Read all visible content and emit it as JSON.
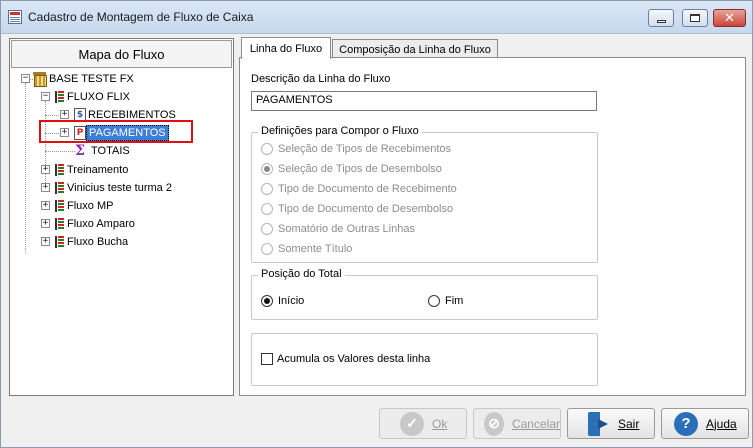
{
  "window": {
    "title": "Cadastro de Montagem de Fluxo de Caixa"
  },
  "left_panel": {
    "header": "Mapa do Fluxo",
    "tree": {
      "root": "BASE TESTE FX",
      "fluxo_flix": "FLUXO FLIX",
      "recebimentos": "RECEBIMENTOS",
      "pagamentos": "PAGAMENTOS",
      "totais": "TOTAIS",
      "treinamento": "Treinamento",
      "vinicius": "Vinicius teste turma 2",
      "fluxo_mp": "Fluxo MP",
      "fluxo_amparo": "Fluxo Amparo",
      "fluxo_bucha": "Fluxo Bucha"
    }
  },
  "tabs": {
    "linha": "Linha do Fluxo",
    "composicao": "Composição da Linha do Fluxo"
  },
  "form": {
    "descricao_label": "Descrição da Linha do Fluxo",
    "descricao_value": "PAGAMENTOS",
    "definicoes_title": "Definições para Compor o Fluxo",
    "options": {
      "o1": "Seleção de Tipos de Recebimentos",
      "o2": "Seleção de Tipos de Desembolso",
      "o3": "Tipo de Documento de Recebimento",
      "o4": "Tipo de Documento de Desembolso",
      "o5": "Somatório de Outras Linhas",
      "o6": "Somente Título"
    },
    "posicao_title": "Posição do Total",
    "inicio": "Início",
    "fim": "Fim",
    "acumula": "Acumula os Valores desta linha"
  },
  "buttons": {
    "ok": "Ok",
    "cancelar": "Cancelar",
    "sair": "Sair",
    "ajuda": "Ajuda"
  },
  "icons": {
    "app": "cash-flow-icon",
    "root": "database-icon",
    "flux": "flux-icon",
    "recebimentos": "receipt-doc-icon",
    "pagamentos": "payment-doc-icon",
    "totais": "sigma-icon",
    "ok": "check-icon",
    "cancel": "cancel-icon",
    "exit": "exit-door-icon",
    "help": "help-icon"
  }
}
